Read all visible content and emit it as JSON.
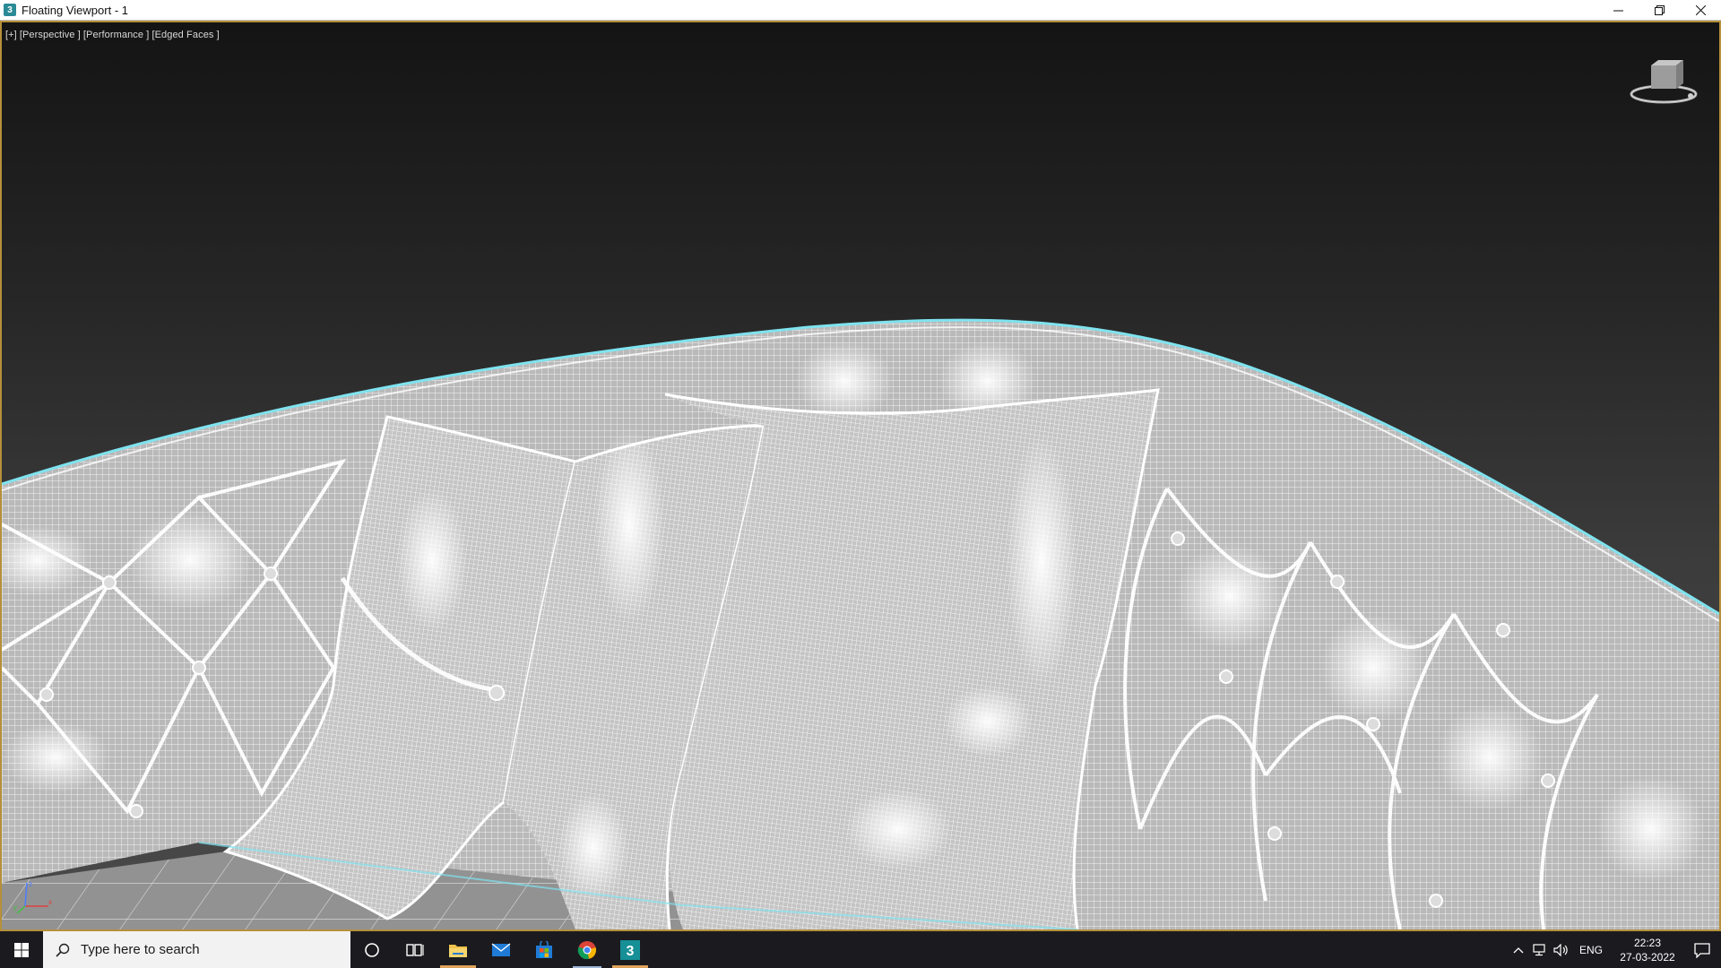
{
  "window": {
    "title": "Floating Viewport - 1",
    "app_icon_glyph": "3",
    "controls": [
      "minimize-icon",
      "restore-icon",
      "close-icon"
    ]
  },
  "viewport": {
    "labels": [
      "[+]",
      "[Perspective ]",
      "[Performance ]",
      "[Edged Faces ]"
    ],
    "border_color": "#b5903a",
    "wireframe_color": "#ffffff",
    "selection_outline_color": "#7fe3ef",
    "scene": "tufted sofa with cushions, edged faces wireframe",
    "axis_labels": {
      "x": "x",
      "y": "y",
      "z": "z"
    }
  },
  "taskbar": {
    "search_placeholder": "Type here to search",
    "apps": [
      "cortana-icon",
      "task-view-icon",
      "file-explorer-icon",
      "mail-icon",
      "store-icon",
      "chrome-icon",
      "3dsmax-icon"
    ],
    "tray": {
      "language": "ENG",
      "time": "22:23",
      "date": "27-03-2022"
    }
  }
}
